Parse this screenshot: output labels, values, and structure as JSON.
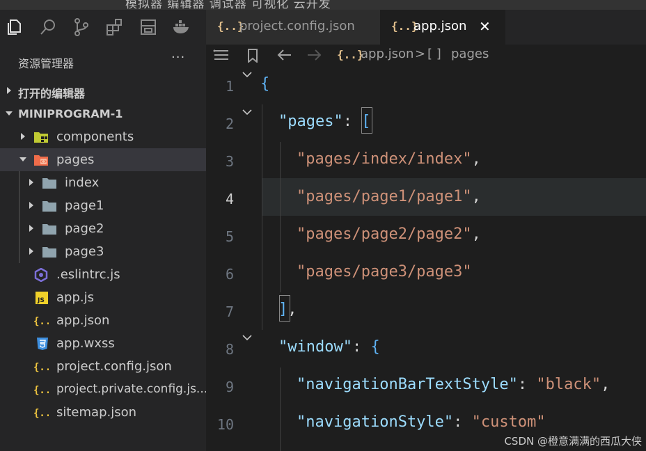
{
  "topbar": {
    "text": "模拟器  编辑器  调试器  可视化  云开发"
  },
  "activity_bar": {
    "icons": [
      "files-icon",
      "search-icon",
      "source-control-icon",
      "extensions-icon",
      "layout-icon",
      "docker-icon"
    ]
  },
  "explorer": {
    "title": "资源管理器",
    "more": "···",
    "sections": {
      "open_editors": "打开的编辑器",
      "project": "MINIPROGRAM-1"
    },
    "tree": [
      {
        "label": "components"
      },
      {
        "label": "pages"
      },
      {
        "label": "index"
      },
      {
        "label": "page1"
      },
      {
        "label": "page2"
      },
      {
        "label": "page3"
      },
      {
        "label": ".eslintrc.js"
      },
      {
        "label": "app.js"
      },
      {
        "label": "app.json"
      },
      {
        "label": "app.wxss"
      },
      {
        "label": "project.config.json"
      },
      {
        "label": "project.private.config.js..."
      },
      {
        "label": "sitemap.json"
      }
    ]
  },
  "tabs": [
    {
      "icon": "{..}",
      "label": "project.config.json",
      "active": false
    },
    {
      "icon": "{..}",
      "label": "app.json",
      "active": true,
      "close": "✕"
    }
  ],
  "breadcrumb": {
    "file_icon": "{..}",
    "file": "app.json",
    "sep": ">",
    "node_icon": "[ ]",
    "node": "pages"
  },
  "editor": {
    "line_numbers": [
      "1",
      "2",
      "3",
      "4",
      "5",
      "6",
      "7",
      "8",
      "9",
      "10"
    ],
    "current_line": "4",
    "code": {
      "l1": "{",
      "l2_key": "\"pages\"",
      "l2_colon": ": ",
      "l2_bracket": "[",
      "l3": "\"pages/index/index\"",
      "l4": "\"pages/page1/page1\"",
      "l5": "\"pages/page2/page2\"",
      "l6": "\"pages/page3/page3\"",
      "comma": ",",
      "l7_bracket": "]",
      "l7_comma": ",",
      "l8_key": "\"window\"",
      "l8_colon": ": ",
      "l8_brace": "{",
      "l9_key": "\"navigationBarTextStyle\"",
      "l9_colon": ": ",
      "l9_val": "\"black\"",
      "l9_comma": ",",
      "l10_key": "\"navigationStyle\"",
      "l10_colon": ": ",
      "l10_val": "\"custom\""
    }
  },
  "watermark": "CSDN @橙意满满的西瓜大侠",
  "colors": {
    "key": "#9cdcfe",
    "string": "#ce9178",
    "bracket": "#5fb3f5",
    "json_icon": "#e2c08d"
  }
}
